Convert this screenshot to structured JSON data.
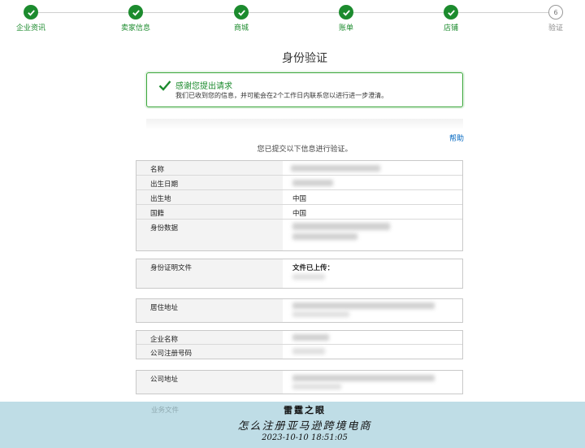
{
  "stepper": {
    "steps": [
      {
        "label": "企业资讯",
        "status": "done"
      },
      {
        "label": "卖家信息",
        "status": "done"
      },
      {
        "label": "商城",
        "status": "done"
      },
      {
        "label": "账单",
        "status": "done"
      },
      {
        "label": "店铺",
        "status": "done"
      },
      {
        "label": "验证",
        "status": "current",
        "number": "6"
      }
    ]
  },
  "page_title": "身份验证",
  "alert": {
    "title": "感谢您提出请求",
    "text": "我们已收到您的信息，并可能会在2个工作日内联系您以进行进一步澄清。"
  },
  "help_link": "帮助",
  "submitted_note": "您已提交以下信息进行验证。",
  "identity": {
    "name_label": "名称",
    "dob_label": "出生日期",
    "birthplace_label": "出生地",
    "birthplace_value": "中国",
    "nationality_label": "国籍",
    "nationality_value": "中国",
    "id_data_label": "身份数据"
  },
  "id_document": {
    "label": "身份证明文件",
    "value": "文件已上传："
  },
  "residence": {
    "label": "居住地址"
  },
  "company": {
    "name_label": "企业名称",
    "reg_label": "公司注册号码"
  },
  "company_address": {
    "label": "公司地址"
  },
  "business_docs": {
    "label": "业务文件"
  },
  "watermark": {
    "line1": "雷霆之眼",
    "line2": "怎么注册亚马逊跨境电商",
    "line3": "2023-10-10 18:51:05"
  },
  "colors": {
    "step_done": "#1c8b2e",
    "alert_border": "#3aa63a",
    "link": "#0066c0",
    "watermark_band": "#bfdde6"
  }
}
